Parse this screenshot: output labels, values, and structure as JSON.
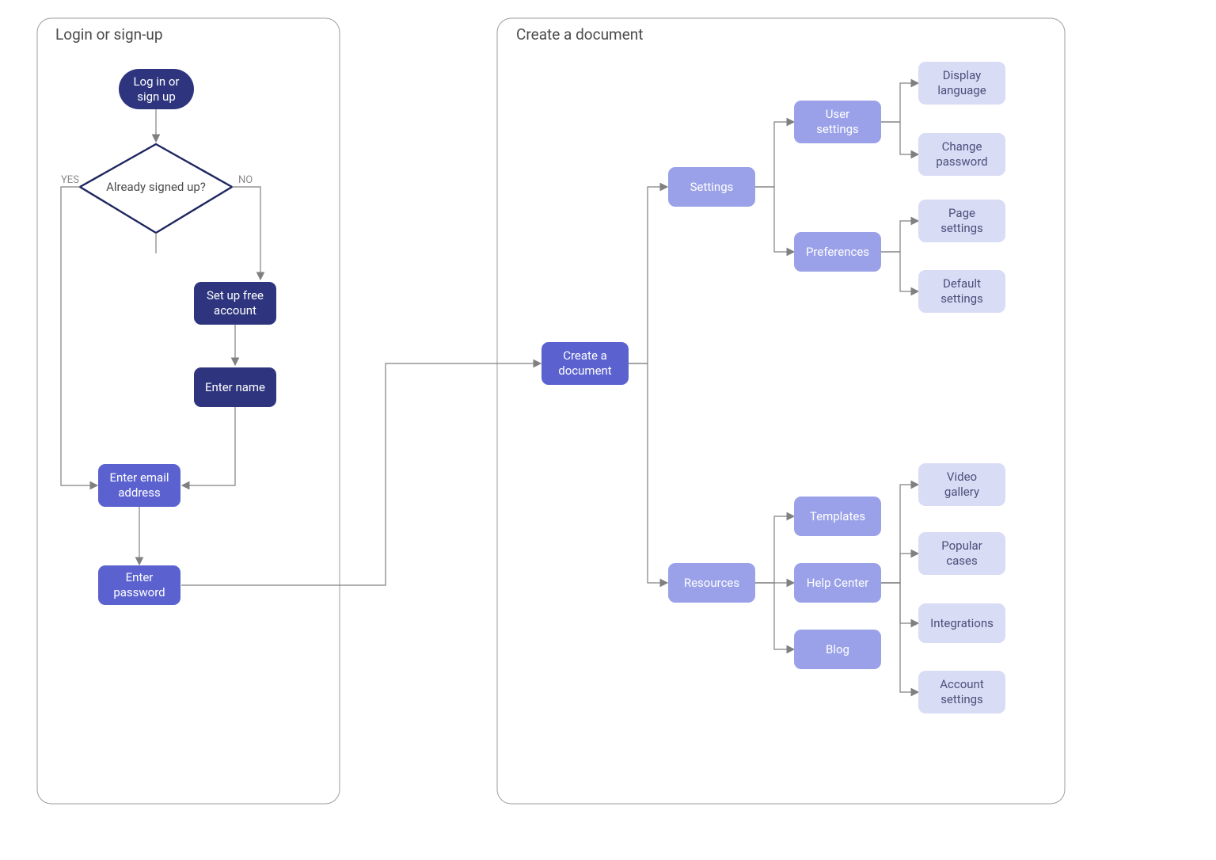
{
  "containers": {
    "login": {
      "title": "Login or sign-up"
    },
    "create": {
      "title": "Create a document"
    }
  },
  "nodes": {
    "start": {
      "label": "Log in or\nsign up"
    },
    "decision": {
      "label": "Already\nsigned up?"
    },
    "setup": {
      "label": "Set up free\naccount"
    },
    "entername": {
      "label": "Enter name"
    },
    "enteremail": {
      "label": "Enter email\naddress"
    },
    "enterpassword": {
      "label": "Enter\npassword"
    },
    "createdoc": {
      "label": "Create a\ndocument"
    },
    "settings": {
      "label": "Settings"
    },
    "resources": {
      "label": "Resources"
    },
    "usersettings": {
      "label": "User\nsettings"
    },
    "preferences": {
      "label": "Preferences"
    },
    "templates": {
      "label": "Templates"
    },
    "helpcenter": {
      "label": "Help Center"
    },
    "blog": {
      "label": "Blog"
    },
    "displaylanguage": {
      "label": "Display\nlanguage"
    },
    "changepassword": {
      "label": "Change\npassword"
    },
    "pagesettings": {
      "label": "Page\nsettings"
    },
    "defaultsettings": {
      "label": "Default\nsettings"
    },
    "videogallery": {
      "label": "Video\ngallery"
    },
    "popularcases": {
      "label": "Popular\ncases"
    },
    "integrations": {
      "label": "Integrations"
    },
    "accountsettings": {
      "label": "Account\nsettings"
    }
  },
  "edgeLabels": {
    "yes": "YES",
    "no": "NO"
  },
  "chart_data": {
    "type": "flowchart",
    "containers": [
      {
        "id": "login",
        "title": "Login or sign-up"
      },
      {
        "id": "create",
        "title": "Create a document"
      }
    ],
    "nodes": [
      {
        "id": "start",
        "shape": "terminator",
        "label": "Log in or sign up",
        "container": "login"
      },
      {
        "id": "decision",
        "shape": "decision",
        "label": "Already signed up?",
        "container": "login"
      },
      {
        "id": "setup",
        "shape": "process",
        "label": "Set up free account",
        "container": "login"
      },
      {
        "id": "entername",
        "shape": "process",
        "label": "Enter name",
        "container": "login"
      },
      {
        "id": "enteremail",
        "shape": "process",
        "label": "Enter email address",
        "container": "login"
      },
      {
        "id": "enterpassword",
        "shape": "process",
        "label": "Enter password",
        "container": "login"
      },
      {
        "id": "createdoc",
        "shape": "process",
        "label": "Create a document",
        "container": "create"
      },
      {
        "id": "settings",
        "shape": "process",
        "label": "Settings",
        "container": "create"
      },
      {
        "id": "resources",
        "shape": "process",
        "label": "Resources",
        "container": "create"
      },
      {
        "id": "usersettings",
        "shape": "process",
        "label": "User settings",
        "container": "create"
      },
      {
        "id": "preferences",
        "shape": "process",
        "label": "Preferences",
        "container": "create"
      },
      {
        "id": "templates",
        "shape": "process",
        "label": "Templates",
        "container": "create"
      },
      {
        "id": "helpcenter",
        "shape": "process",
        "label": "Help Center",
        "container": "create"
      },
      {
        "id": "blog",
        "shape": "process",
        "label": "Blog",
        "container": "create"
      },
      {
        "id": "displaylanguage",
        "shape": "process",
        "label": "Display language",
        "container": "create"
      },
      {
        "id": "changepassword",
        "shape": "process",
        "label": "Change password",
        "container": "create"
      },
      {
        "id": "pagesettings",
        "shape": "process",
        "label": "Page settings",
        "container": "create"
      },
      {
        "id": "defaultsettings",
        "shape": "process",
        "label": "Default settings",
        "container": "create"
      },
      {
        "id": "videogallery",
        "shape": "process",
        "label": "Video gallery",
        "container": "create"
      },
      {
        "id": "popularcases",
        "shape": "process",
        "label": "Popular cases",
        "container": "create"
      },
      {
        "id": "integrations",
        "shape": "process",
        "label": "Integrations",
        "container": "create"
      },
      {
        "id": "accountsettings",
        "shape": "process",
        "label": "Account settings",
        "container": "create"
      }
    ],
    "edges": [
      {
        "from": "start",
        "to": "decision"
      },
      {
        "from": "decision",
        "to": "enteremail",
        "label": "YES"
      },
      {
        "from": "decision",
        "to": "setup",
        "label": "NO"
      },
      {
        "from": "setup",
        "to": "entername"
      },
      {
        "from": "entername",
        "to": "enteremail"
      },
      {
        "from": "enteremail",
        "to": "enterpassword"
      },
      {
        "from": "enterpassword",
        "to": "createdoc"
      },
      {
        "from": "createdoc",
        "to": "settings"
      },
      {
        "from": "createdoc",
        "to": "resources"
      },
      {
        "from": "settings",
        "to": "usersettings"
      },
      {
        "from": "settings",
        "to": "preferences"
      },
      {
        "from": "resources",
        "to": "templates"
      },
      {
        "from": "resources",
        "to": "helpcenter"
      },
      {
        "from": "resources",
        "to": "blog"
      },
      {
        "from": "usersettings",
        "to": "displaylanguage"
      },
      {
        "from": "usersettings",
        "to": "changepassword"
      },
      {
        "from": "preferences",
        "to": "pagesettings"
      },
      {
        "from": "preferences",
        "to": "defaultsettings"
      },
      {
        "from": "helpcenter",
        "to": "videogallery"
      },
      {
        "from": "helpcenter",
        "to": "popularcases"
      },
      {
        "from": "helpcenter",
        "to": "integrations"
      },
      {
        "from": "helpcenter",
        "to": "accountsettings"
      }
    ]
  }
}
